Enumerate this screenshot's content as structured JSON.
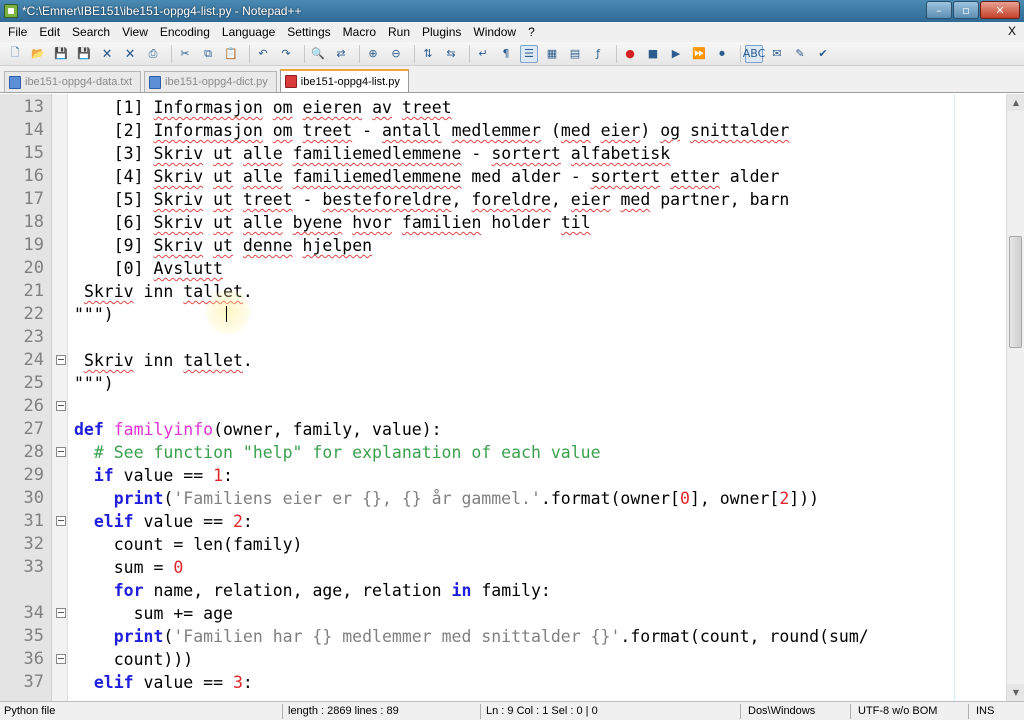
{
  "window": {
    "title": "*C:\\Emner\\IBE151\\ibe151-oppg4-list.py - Notepad++",
    "controls": {
      "minimize": "–",
      "maximize": "▫",
      "close": "✕"
    }
  },
  "menu": {
    "items": [
      "File",
      "Edit",
      "Search",
      "View",
      "Encoding",
      "Language",
      "Settings",
      "Macro",
      "Run",
      "Plugins",
      "Window",
      "?"
    ],
    "close_label": "X"
  },
  "tabs": [
    {
      "label": "ibe151-oppg4-data.txt",
      "active": false,
      "icon": "saved-file-icon"
    },
    {
      "label": "ibe151-oppg4-dict.py",
      "active": false,
      "icon": "saved-file-icon"
    },
    {
      "label": "ibe151-oppg4-list.py",
      "active": true,
      "icon": "unsaved-file-icon"
    }
  ],
  "editor": {
    "lines": [
      {
        "num": "13",
        "fold": false,
        "tokens": [
          [
            "    ",
            ""
          ],
          [
            "[1] ",
            ""
          ],
          [
            "Informasjon",
            "squig"
          ],
          [
            " ",
            ""
          ],
          [
            "om",
            "squig"
          ],
          [
            " ",
            ""
          ],
          [
            "eieren",
            "squig"
          ],
          [
            " ",
            ""
          ],
          [
            "av",
            "squig"
          ],
          [
            " ",
            ""
          ],
          [
            "treet",
            "squig"
          ]
        ]
      },
      {
        "num": "14",
        "fold": false,
        "tokens": [
          [
            "    ",
            ""
          ],
          [
            "[2] ",
            ""
          ],
          [
            "Informasjon",
            "squig"
          ],
          [
            " ",
            ""
          ],
          [
            "om",
            "squig"
          ],
          [
            " ",
            ""
          ],
          [
            "treet",
            "squig"
          ],
          [
            " - ",
            ""
          ],
          [
            "antall",
            "squig"
          ],
          [
            " ",
            ""
          ],
          [
            "medlemmer",
            "squig"
          ],
          [
            " (",
            ""
          ],
          [
            "med",
            "squig"
          ],
          [
            " ",
            ""
          ],
          [
            "eier",
            "squig"
          ],
          [
            ") ",
            ""
          ],
          [
            "og",
            "squig"
          ],
          [
            " ",
            ""
          ],
          [
            "snittalder",
            "squig"
          ]
        ]
      },
      {
        "num": "15",
        "fold": false,
        "tokens": [
          [
            "    ",
            ""
          ],
          [
            "[3] ",
            ""
          ],
          [
            "Skriv",
            "squig"
          ],
          [
            " ",
            ""
          ],
          [
            "ut",
            "squig"
          ],
          [
            " ",
            ""
          ],
          [
            "alle",
            "squig"
          ],
          [
            " ",
            ""
          ],
          [
            "familiemedlemmene",
            "squig"
          ],
          [
            " - ",
            ""
          ],
          [
            "sortert",
            "squig"
          ],
          [
            " ",
            ""
          ],
          [
            "alfabetisk",
            "squig"
          ]
        ]
      },
      {
        "num": "16",
        "fold": false,
        "tokens": [
          [
            "    ",
            ""
          ],
          [
            "[4] ",
            ""
          ],
          [
            "Skriv",
            "squig"
          ],
          [
            " ",
            ""
          ],
          [
            "ut",
            "squig"
          ],
          [
            " ",
            ""
          ],
          [
            "alle",
            "squig"
          ],
          [
            " ",
            ""
          ],
          [
            "familiemedlemmene",
            "squig"
          ],
          [
            " med alder - ",
            ""
          ],
          [
            "sortert",
            "squig"
          ],
          [
            " ",
            ""
          ],
          [
            "etter",
            "squig"
          ],
          [
            " alder",
            ""
          ]
        ]
      },
      {
        "num": "17",
        "fold": false,
        "tokens": [
          [
            "    ",
            ""
          ],
          [
            "[5] ",
            ""
          ],
          [
            "Skriv",
            "squig"
          ],
          [
            " ",
            ""
          ],
          [
            "ut",
            "squig"
          ],
          [
            " ",
            ""
          ],
          [
            "treet",
            "squig"
          ],
          [
            " - ",
            ""
          ],
          [
            "besteforeldre",
            "squig"
          ],
          [
            ", ",
            ""
          ],
          [
            "foreldre",
            "squig"
          ],
          [
            ", ",
            ""
          ],
          [
            "eier",
            "squig"
          ],
          [
            " ",
            ""
          ],
          [
            "med",
            "squig"
          ],
          [
            " partner, barn",
            ""
          ]
        ]
      },
      {
        "num": "18",
        "fold": false,
        "tokens": [
          [
            "    ",
            ""
          ],
          [
            "[6] ",
            ""
          ],
          [
            "Skriv",
            "squig"
          ],
          [
            " ",
            ""
          ],
          [
            "ut",
            "squig"
          ],
          [
            " ",
            ""
          ],
          [
            "alle",
            "squig"
          ],
          [
            " ",
            ""
          ],
          [
            "byene",
            "squig"
          ],
          [
            " ",
            ""
          ],
          [
            "hvor",
            "squig"
          ],
          [
            " ",
            ""
          ],
          [
            "familien",
            "squig"
          ],
          [
            " holder ",
            ""
          ],
          [
            "til",
            "squig"
          ]
        ]
      },
      {
        "num": "19",
        "fold": false,
        "tokens": [
          [
            "    ",
            ""
          ],
          [
            "[9] ",
            ""
          ],
          [
            "Skriv",
            "squig"
          ],
          [
            " ",
            ""
          ],
          [
            "ut",
            "squig"
          ],
          [
            " ",
            ""
          ],
          [
            "denne",
            "squig"
          ],
          [
            " ",
            ""
          ],
          [
            "hjelpen",
            "squig"
          ]
        ]
      },
      {
        "num": "20",
        "fold": false,
        "tokens": [
          [
            "    ",
            ""
          ],
          [
            "[0] ",
            ""
          ],
          [
            "Avslutt",
            "squig"
          ]
        ]
      },
      {
        "num": "21",
        "fold": false,
        "tokens": [
          [
            " ",
            ""
          ],
          [
            "Skriv",
            "squig"
          ],
          [
            " inn ",
            ""
          ],
          [
            "tallet",
            "squig"
          ],
          [
            ".",
            ""
          ]
        ]
      },
      {
        "num": "22",
        "fold": false,
        "tokens": [
          [
            "\"\"\")",
            ""
          ]
        ]
      },
      {
        "num": "23",
        "fold": false,
        "tokens": []
      },
      {
        "num": "24",
        "fold": true,
        "tokens": [
          [
            " ",
            ""
          ],
          [
            "Skriv",
            "squig"
          ],
          [
            " inn ",
            ""
          ],
          [
            "tallet",
            "squig"
          ],
          [
            ".",
            ""
          ]
        ]
      },
      {
        "num": "25",
        "fold": false,
        "tokens": [
          [
            "\"\"\")",
            ""
          ]
        ]
      },
      {
        "num": "26",
        "fold": true,
        "tokens": []
      },
      {
        "num": "27",
        "fold": false,
        "tokens": [
          [
            "def",
            "kw"
          ],
          [
            " ",
            ""
          ],
          [
            "familyinfo",
            "fn"
          ],
          [
            "(owner, family, value):",
            ""
          ]
        ]
      },
      {
        "num": "28",
        "fold": true,
        "tokens": [
          [
            "  ",
            ""
          ],
          [
            "# See function \"help\" for explanation of each value",
            "com"
          ]
        ]
      },
      {
        "num": "29",
        "fold": false,
        "tokens": [
          [
            "  ",
            ""
          ],
          [
            "if",
            "kw"
          ],
          [
            " value == ",
            ""
          ],
          [
            "1",
            "num"
          ],
          [
            ":",
            ""
          ]
        ]
      },
      {
        "num": "30",
        "fold": false,
        "tokens": [
          [
            "    ",
            ""
          ],
          [
            "print",
            "kw"
          ],
          [
            "(",
            ""
          ],
          [
            "'Familiens eier er {}, {} år gammel.'",
            "str"
          ],
          [
            ".format(owner[",
            ""
          ],
          [
            "0",
            "num"
          ],
          [
            "], owner[",
            ""
          ],
          [
            "2",
            "num"
          ],
          [
            "]))",
            ""
          ]
        ]
      },
      {
        "num": "31",
        "fold": true,
        "tokens": [
          [
            "  ",
            ""
          ],
          [
            "elif",
            "kw"
          ],
          [
            " value == ",
            ""
          ],
          [
            "2",
            "num"
          ],
          [
            ":",
            ""
          ]
        ]
      },
      {
        "num": "32",
        "fold": false,
        "tokens": [
          [
            "    count = len(family)",
            ""
          ]
        ]
      },
      {
        "num": "33",
        "fold": false,
        "tokens": [
          [
            "    sum = ",
            ""
          ],
          [
            "0",
            "num"
          ]
        ]
      },
      {
        "num": "",
        "fold": false,
        "tokens": [
          [
            "    ",
            ""
          ],
          [
            "for",
            "kw"
          ],
          [
            " name, relation, age, relation ",
            ""
          ],
          [
            "in",
            "kw"
          ],
          [
            " family:",
            ""
          ]
        ]
      },
      {
        "num": "34",
        "fold": true,
        "tokens": [
          [
            "      sum += age",
            ""
          ]
        ]
      },
      {
        "num": "35",
        "fold": false,
        "tokens": [
          [
            "    ",
            ""
          ],
          [
            "print",
            "kw"
          ],
          [
            "(",
            ""
          ],
          [
            "'Familien har {} medlemmer med snittalder {}'",
            "str"
          ],
          [
            ".format(count, round(sum/",
            ""
          ]
        ]
      },
      {
        "num": "36",
        "fold": true,
        "tokens": [
          [
            "    count)))",
            ""
          ]
        ]
      },
      {
        "num": "37",
        "fold": false,
        "tokens": [
          [
            "  ",
            ""
          ],
          [
            "elif",
            "kw"
          ],
          [
            " value == ",
            ""
          ],
          [
            "3",
            "num"
          ],
          [
            ":",
            ""
          ]
        ]
      }
    ]
  },
  "status": {
    "language": "Python file",
    "length": "length : 2869    lines : 89",
    "position": "Ln : 9    Col : 1    Sel : 0 | 0",
    "eol": "Dos\\Windows",
    "encoding": "UTF-8 w/o BOM",
    "mode": "INS"
  }
}
